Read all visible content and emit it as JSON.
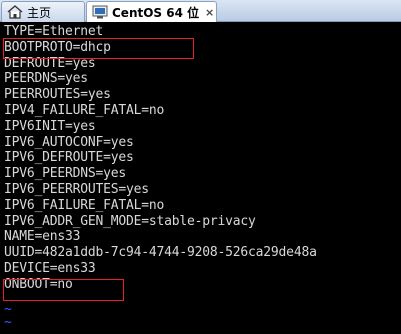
{
  "tabs": [
    {
      "label": "主页",
      "icon": "home-icon",
      "active": false
    },
    {
      "label": "CentOS 64 位",
      "icon": "vm-icon",
      "active": true,
      "close": "×"
    }
  ],
  "terminal": {
    "lines": [
      "TYPE=Ethernet",
      "BOOTPROTO=dhcp",
      "DEFROUTE=yes",
      "PEERDNS=yes",
      "PEERROUTES=yes",
      "IPV4_FAILURE_FATAL=no",
      "IPV6INIT=yes",
      "IPV6_AUTOCONF=yes",
      "IPV6_DEFROUTE=yes",
      "IPV6_PEERDNS=yes",
      "IPV6_PEERROUTES=yes",
      "IPV6_FAILURE_FATAL=no",
      "IPV6_ADDR_GEN_MODE=stable-privacy",
      "NAME=ens33",
      "UUID=482a1ddb-7c94-4744-9208-526ca29de48a",
      "DEVICE=ens33",
      "ONBOOT=no"
    ],
    "tilde": "~"
  },
  "colors": {
    "text": "#d8d8d8",
    "tilde": "#3a5bff",
    "highlight": "#e8202a",
    "background": "#000000"
  }
}
